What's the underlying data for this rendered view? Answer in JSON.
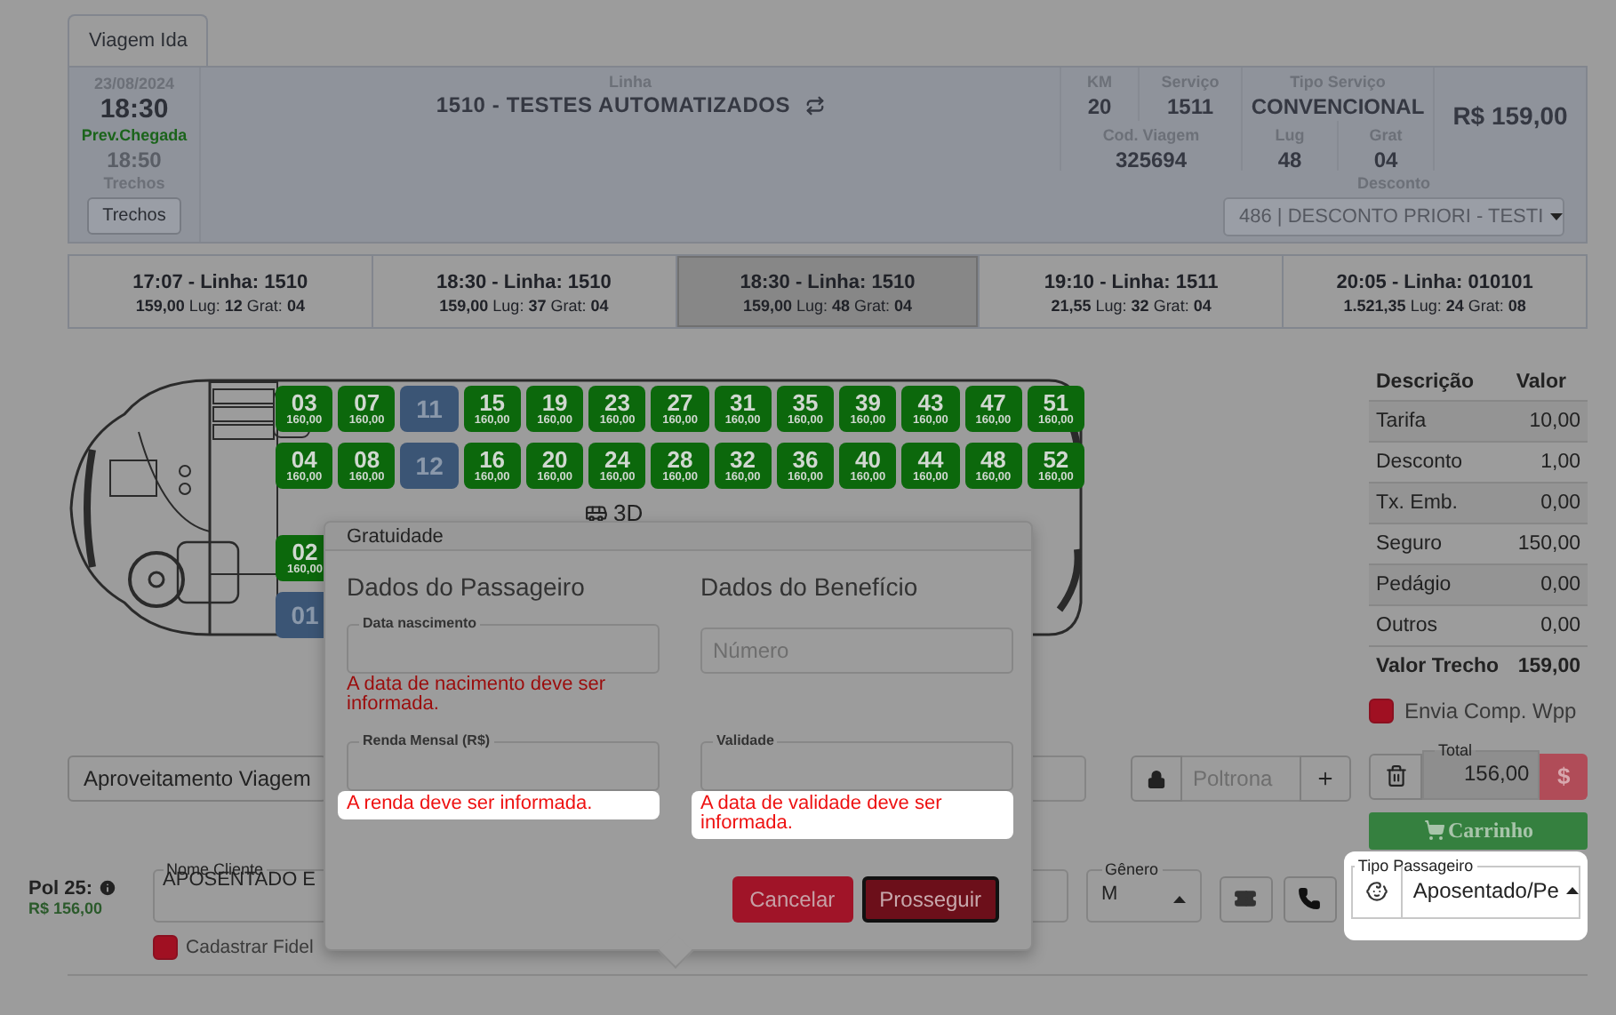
{
  "tab": {
    "label": "Viagem Ida",
    "selected": true
  },
  "trip": {
    "date": "23/08/2024",
    "departure": "18:30",
    "arrival_label": "Prev.Chegada",
    "arrival": "18:50",
    "segments_label": "Trechos",
    "segments_button": "Trechos",
    "line_label": "Linha",
    "line": "1510 - TESTES AUTOMATIZADOS",
    "km_label": "KM",
    "km": "20",
    "service_label": "Serviço",
    "service": "1511",
    "code_label": "Cod. Viagem",
    "code": "325694",
    "type_label": "Tipo Serviço",
    "type": "CONVENCIONAL",
    "seats_label": "Lug",
    "seats": "48",
    "free_label": "Grat",
    "free": "04",
    "price": "R$ 159,00",
    "discount_label": "Desconto",
    "discount": "486 | DESCONTO PRIORI - TESTI"
  },
  "departures": [
    {
      "title": "17:07 - Linha: 1510",
      "fare": "**159,00** Lug: **12** Grat: **04**",
      "selected": false
    },
    {
      "title": "18:30 - Linha: 1510",
      "fare": "**159,00** Lug: **37** Grat: **04**",
      "selected": false
    },
    {
      "title": "18:30 - Linha: 1510",
      "fare": "**159,00** Lug: **48** Grat: **04**",
      "selected": true
    },
    {
      "title": "19:10 - Linha: 1511",
      "fare": "**21,55** Lug: **32** Grat: **04**",
      "selected": false
    },
    {
      "title": "20:05 - Linha: 010101",
      "fare": "**1.521,35** Lug: **24** Grat: **08**",
      "selected": false
    }
  ],
  "seat_map": {
    "rows": [
      [
        {
          "number": "03",
          "price": "160,00",
          "kind": "available"
        },
        {
          "number": "07",
          "price": "160,00",
          "kind": "available"
        },
        {
          "number": "11",
          "kind": "blocked"
        },
        {
          "number": "15",
          "price": "160,00",
          "kind": "available"
        },
        {
          "number": "19",
          "price": "160,00",
          "kind": "available"
        },
        {
          "number": "23",
          "price": "160,00",
          "kind": "available"
        },
        {
          "number": "27",
          "price": "160,00",
          "kind": "available"
        },
        {
          "number": "31",
          "price": "160,00",
          "kind": "available"
        },
        {
          "number": "35",
          "price": "160,00",
          "kind": "available"
        },
        {
          "number": "39",
          "price": "160,00",
          "kind": "available"
        },
        {
          "number": "43",
          "price": "160,00",
          "kind": "available"
        },
        {
          "number": "47",
          "price": "160,00",
          "kind": "available"
        },
        {
          "number": "51",
          "price": "160,00",
          "kind": "available"
        }
      ],
      [
        {
          "number": "04",
          "price": "160,00",
          "kind": "available"
        },
        {
          "number": "08",
          "price": "160,00",
          "kind": "available"
        },
        {
          "number": "12",
          "kind": "blocked"
        },
        {
          "number": "16",
          "price": "160,00",
          "kind": "available"
        },
        {
          "number": "20",
          "price": "160,00",
          "kind": "available"
        },
        {
          "number": "24",
          "price": "160,00",
          "kind": "available"
        },
        {
          "number": "28",
          "price": "160,00",
          "kind": "available"
        },
        {
          "number": "32",
          "price": "160,00",
          "kind": "available"
        },
        {
          "number": "36",
          "price": "160,00",
          "kind": "available"
        },
        {
          "number": "40",
          "price": "160,00",
          "kind": "available"
        },
        {
          "number": "44",
          "price": "160,00",
          "kind": "available"
        },
        {
          "number": "48",
          "price": "160,00",
          "kind": "available"
        },
        {
          "number": "52",
          "price": "160,00",
          "kind": "available"
        }
      ]
    ],
    "floor_label": "3D",
    "lower_rows": [
      [
        {
          "number": "02",
          "price": "160,00",
          "kind": "available"
        }
      ],
      [
        {
          "number": "01",
          "kind": "blocked"
        }
      ]
    ]
  },
  "fares": {
    "columns": [
      "Descrição",
      "Valor"
    ],
    "rows": [
      {
        "label": "Tarifa",
        "value": "10,00"
      },
      {
        "label": "Desconto",
        "value": "1,00"
      },
      {
        "label": "Tx. Emb.",
        "value": "0,00"
      },
      {
        "label": "Seguro",
        "value": "150,00"
      },
      {
        "label": "Pedágio",
        "value": "0,00"
      },
      {
        "label": "Outros",
        "value": "0,00"
      }
    ],
    "total": {
      "label": "Valor Trecho",
      "value": "159,00"
    }
  },
  "whatsapp": {
    "label": "Envia Comp. Wpp",
    "checked": true
  },
  "actions": {
    "reuse_button": "Aproveitamento Viagem",
    "seat_placeholder": "Poltrona",
    "total_label": "Total",
    "total": "156,00",
    "pay_button": "$",
    "cart_button": "Carrinho"
  },
  "passenger": {
    "seat": "Pol 25:",
    "price": "R$ 156,00",
    "name_label": "Nome Cliente",
    "name": "APOSENTADO E",
    "gender_label": "Gênero",
    "gender": "M",
    "type_label": "Tipo Passageiro",
    "type": "Aposentado/Pe",
    "type_highlighted": true,
    "fidelity": {
      "label": "Cadastrar Fidel",
      "checked": true
    }
  },
  "modal": {
    "title": "Gratuidade",
    "passenger_heading": "Dados do Passageiro",
    "benefit_heading": "Dados do Benefício",
    "birth": {
      "label": "Data nascimento",
      "error": "A data de nacimento deve ser informada.",
      "highlighted": false
    },
    "income": {
      "label": "Renda Mensal (R$)",
      "error": "A renda deve ser informada.",
      "highlighted": true
    },
    "number": {
      "placeholder": "Número"
    },
    "validity": {
      "label": "Validade",
      "error": "A data de validade deve ser informada.",
      "highlighted": true
    },
    "cancel": "Cancelar",
    "proceed": "Prosseguir"
  }
}
